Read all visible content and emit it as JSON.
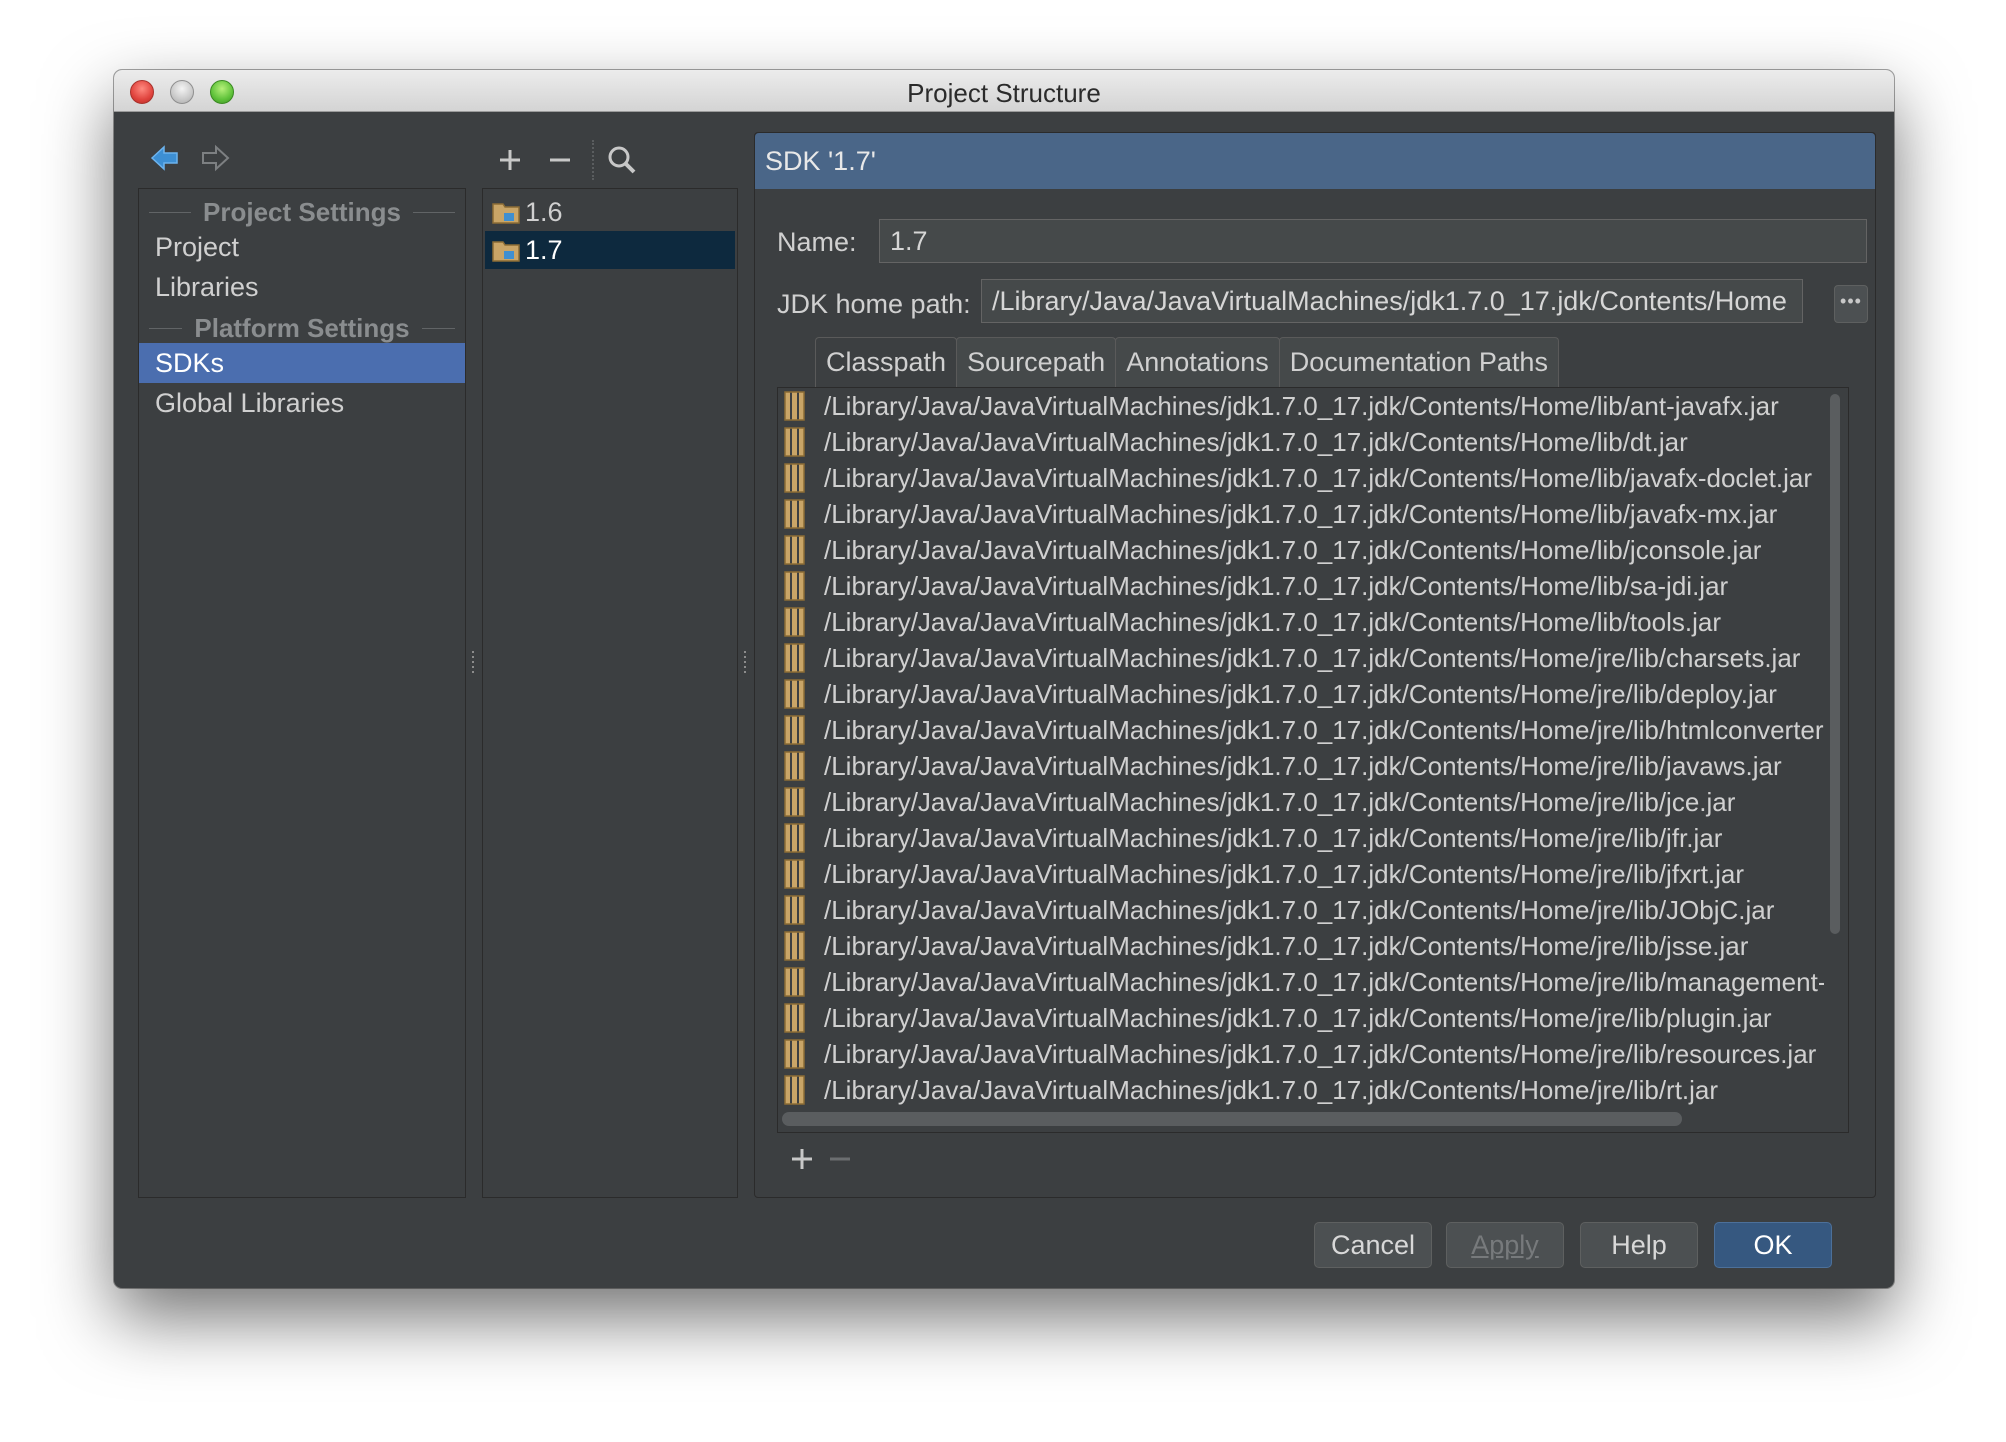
{
  "window": {
    "title": "Project Structure"
  },
  "nav": {
    "back_icon": "arrow-left-icon",
    "forward_icon": "arrow-right-icon"
  },
  "left": {
    "project_settings_header": "Project Settings",
    "platform_settings_header": "Platform Settings",
    "items": [
      {
        "label": "Project",
        "selected": false
      },
      {
        "label": "Libraries",
        "selected": false
      },
      {
        "label": "SDKs",
        "selected": true
      },
      {
        "label": "Global Libraries",
        "selected": false
      }
    ]
  },
  "sdk_list": {
    "toolbar": [
      "plus-icon",
      "minus-icon",
      "search-icon"
    ],
    "items": [
      {
        "label": "1.6",
        "selected": false
      },
      {
        "label": "1.7",
        "selected": true
      }
    ]
  },
  "detail": {
    "header": "SDK '1.7'",
    "name_label": "Name:",
    "name_value": "1.7",
    "jdk_label": "JDK home path:",
    "jdk_value": "/Library/Java/JavaVirtualMachines/jdk1.7.0_17.jdk/Contents/Home",
    "browse_label": "•••",
    "tabs": [
      "Classpath",
      "Sourcepath",
      "Annotations",
      "Documentation Paths"
    ],
    "active_tab": "Classpath",
    "classpath": [
      "/Library/Java/JavaVirtualMachines/jdk1.7.0_17.jdk/Contents/Home/lib/ant-javafx.jar",
      "/Library/Java/JavaVirtualMachines/jdk1.7.0_17.jdk/Contents/Home/lib/dt.jar",
      "/Library/Java/JavaVirtualMachines/jdk1.7.0_17.jdk/Contents/Home/lib/javafx-doclet.jar",
      "/Library/Java/JavaVirtualMachines/jdk1.7.0_17.jdk/Contents/Home/lib/javafx-mx.jar",
      "/Library/Java/JavaVirtualMachines/jdk1.7.0_17.jdk/Contents/Home/lib/jconsole.jar",
      "/Library/Java/JavaVirtualMachines/jdk1.7.0_17.jdk/Contents/Home/lib/sa-jdi.jar",
      "/Library/Java/JavaVirtualMachines/jdk1.7.0_17.jdk/Contents/Home/lib/tools.jar",
      "/Library/Java/JavaVirtualMachines/jdk1.7.0_17.jdk/Contents/Home/jre/lib/charsets.jar",
      "/Library/Java/JavaVirtualMachines/jdk1.7.0_17.jdk/Contents/Home/jre/lib/deploy.jar",
      "/Library/Java/JavaVirtualMachines/jdk1.7.0_17.jdk/Contents/Home/jre/lib/htmlconverter.jar",
      "/Library/Java/JavaVirtualMachines/jdk1.7.0_17.jdk/Contents/Home/jre/lib/javaws.jar",
      "/Library/Java/JavaVirtualMachines/jdk1.7.0_17.jdk/Contents/Home/jre/lib/jce.jar",
      "/Library/Java/JavaVirtualMachines/jdk1.7.0_17.jdk/Contents/Home/jre/lib/jfr.jar",
      "/Library/Java/JavaVirtualMachines/jdk1.7.0_17.jdk/Contents/Home/jre/lib/jfxrt.jar",
      "/Library/Java/JavaVirtualMachines/jdk1.7.0_17.jdk/Contents/Home/jre/lib/JObjC.jar",
      "/Library/Java/JavaVirtualMachines/jdk1.7.0_17.jdk/Contents/Home/jre/lib/jsse.jar",
      "/Library/Java/JavaVirtualMachines/jdk1.7.0_17.jdk/Contents/Home/jre/lib/management-agent.jar",
      "/Library/Java/JavaVirtualMachines/jdk1.7.0_17.jdk/Contents/Home/jre/lib/plugin.jar",
      "/Library/Java/JavaVirtualMachines/jdk1.7.0_17.jdk/Contents/Home/jre/lib/resources.jar",
      "/Library/Java/JavaVirtualMachines/jdk1.7.0_17.jdk/Contents/Home/jre/lib/rt.jar"
    ],
    "footer_icons": [
      "plus-icon",
      "minus-icon"
    ]
  },
  "buttons": {
    "cancel": "Cancel",
    "apply": "Apply",
    "help": "Help",
    "ok": "OK"
  },
  "colors": {
    "background": "#3c3f41",
    "selection": "#4b6eaf",
    "sdk_selection": "#0d293e",
    "header": "#4a6688",
    "ok_button": "#365880"
  }
}
